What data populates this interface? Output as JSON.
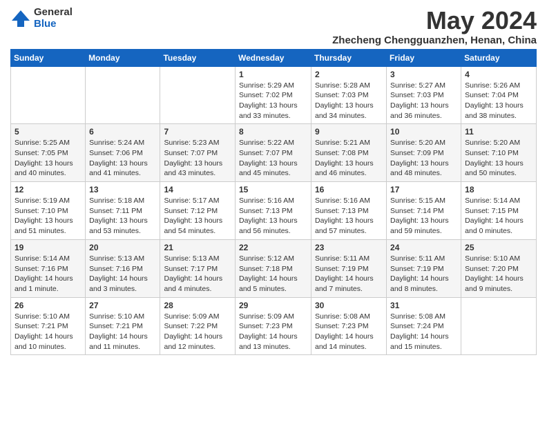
{
  "logo": {
    "general": "General",
    "blue": "Blue"
  },
  "title": "May 2024",
  "location": "Zhecheng Chengguanzhen, Henan, China",
  "days_of_week": [
    "Sunday",
    "Monday",
    "Tuesday",
    "Wednesday",
    "Thursday",
    "Friday",
    "Saturday"
  ],
  "weeks": [
    [
      {
        "day": "",
        "info": ""
      },
      {
        "day": "",
        "info": ""
      },
      {
        "day": "",
        "info": ""
      },
      {
        "day": "1",
        "info": "Sunrise: 5:29 AM\nSunset: 7:02 PM\nDaylight: 13 hours\nand 33 minutes."
      },
      {
        "day": "2",
        "info": "Sunrise: 5:28 AM\nSunset: 7:03 PM\nDaylight: 13 hours\nand 34 minutes."
      },
      {
        "day": "3",
        "info": "Sunrise: 5:27 AM\nSunset: 7:03 PM\nDaylight: 13 hours\nand 36 minutes."
      },
      {
        "day": "4",
        "info": "Sunrise: 5:26 AM\nSunset: 7:04 PM\nDaylight: 13 hours\nand 38 minutes."
      }
    ],
    [
      {
        "day": "5",
        "info": "Sunrise: 5:25 AM\nSunset: 7:05 PM\nDaylight: 13 hours\nand 40 minutes."
      },
      {
        "day": "6",
        "info": "Sunrise: 5:24 AM\nSunset: 7:06 PM\nDaylight: 13 hours\nand 41 minutes."
      },
      {
        "day": "7",
        "info": "Sunrise: 5:23 AM\nSunset: 7:07 PM\nDaylight: 13 hours\nand 43 minutes."
      },
      {
        "day": "8",
        "info": "Sunrise: 5:22 AM\nSunset: 7:07 PM\nDaylight: 13 hours\nand 45 minutes."
      },
      {
        "day": "9",
        "info": "Sunrise: 5:21 AM\nSunset: 7:08 PM\nDaylight: 13 hours\nand 46 minutes."
      },
      {
        "day": "10",
        "info": "Sunrise: 5:20 AM\nSunset: 7:09 PM\nDaylight: 13 hours\nand 48 minutes."
      },
      {
        "day": "11",
        "info": "Sunrise: 5:20 AM\nSunset: 7:10 PM\nDaylight: 13 hours\nand 50 minutes."
      }
    ],
    [
      {
        "day": "12",
        "info": "Sunrise: 5:19 AM\nSunset: 7:10 PM\nDaylight: 13 hours\nand 51 minutes."
      },
      {
        "day": "13",
        "info": "Sunrise: 5:18 AM\nSunset: 7:11 PM\nDaylight: 13 hours\nand 53 minutes."
      },
      {
        "day": "14",
        "info": "Sunrise: 5:17 AM\nSunset: 7:12 PM\nDaylight: 13 hours\nand 54 minutes."
      },
      {
        "day": "15",
        "info": "Sunrise: 5:16 AM\nSunset: 7:13 PM\nDaylight: 13 hours\nand 56 minutes."
      },
      {
        "day": "16",
        "info": "Sunrise: 5:16 AM\nSunset: 7:13 PM\nDaylight: 13 hours\nand 57 minutes."
      },
      {
        "day": "17",
        "info": "Sunrise: 5:15 AM\nSunset: 7:14 PM\nDaylight: 13 hours\nand 59 minutes."
      },
      {
        "day": "18",
        "info": "Sunrise: 5:14 AM\nSunset: 7:15 PM\nDaylight: 14 hours\nand 0 minutes."
      }
    ],
    [
      {
        "day": "19",
        "info": "Sunrise: 5:14 AM\nSunset: 7:16 PM\nDaylight: 14 hours\nand 1 minute."
      },
      {
        "day": "20",
        "info": "Sunrise: 5:13 AM\nSunset: 7:16 PM\nDaylight: 14 hours\nand 3 minutes."
      },
      {
        "day": "21",
        "info": "Sunrise: 5:13 AM\nSunset: 7:17 PM\nDaylight: 14 hours\nand 4 minutes."
      },
      {
        "day": "22",
        "info": "Sunrise: 5:12 AM\nSunset: 7:18 PM\nDaylight: 14 hours\nand 5 minutes."
      },
      {
        "day": "23",
        "info": "Sunrise: 5:11 AM\nSunset: 7:19 PM\nDaylight: 14 hours\nand 7 minutes."
      },
      {
        "day": "24",
        "info": "Sunrise: 5:11 AM\nSunset: 7:19 PM\nDaylight: 14 hours\nand 8 minutes."
      },
      {
        "day": "25",
        "info": "Sunrise: 5:10 AM\nSunset: 7:20 PM\nDaylight: 14 hours\nand 9 minutes."
      }
    ],
    [
      {
        "day": "26",
        "info": "Sunrise: 5:10 AM\nSunset: 7:21 PM\nDaylight: 14 hours\nand 10 minutes."
      },
      {
        "day": "27",
        "info": "Sunrise: 5:10 AM\nSunset: 7:21 PM\nDaylight: 14 hours\nand 11 minutes."
      },
      {
        "day": "28",
        "info": "Sunrise: 5:09 AM\nSunset: 7:22 PM\nDaylight: 14 hours\nand 12 minutes."
      },
      {
        "day": "29",
        "info": "Sunrise: 5:09 AM\nSunset: 7:23 PM\nDaylight: 14 hours\nand 13 minutes."
      },
      {
        "day": "30",
        "info": "Sunrise: 5:08 AM\nSunset: 7:23 PM\nDaylight: 14 hours\nand 14 minutes."
      },
      {
        "day": "31",
        "info": "Sunrise: 5:08 AM\nSunset: 7:24 PM\nDaylight: 14 hours\nand 15 minutes."
      },
      {
        "day": "",
        "info": ""
      }
    ]
  ]
}
